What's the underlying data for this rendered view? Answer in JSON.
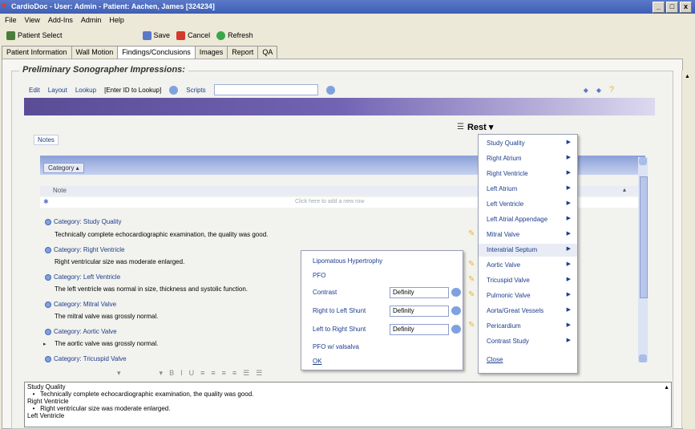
{
  "window": {
    "title": "CardioDoc - User: Admin - Patient: Aachen, James [324234]",
    "controls": [
      "_",
      "□",
      "x"
    ]
  },
  "menubar": [
    "File",
    "View",
    "Add-Ins",
    "Admin",
    "Help"
  ],
  "toolbar": {
    "patient_select": "Patient Select",
    "save": "Save",
    "cancel": "Cancel",
    "refresh": "Refresh"
  },
  "tabs": [
    "Patient Information",
    "Wall Motion",
    "Findings/Conclusions",
    "Images",
    "Report",
    "QA"
  ],
  "active_tab": "Findings/Conclusions",
  "section_title": "Preliminary Sonographer Impressions:",
  "inner_toolbar": {
    "edit": "Edit",
    "layout": "Layout",
    "lookup": "Lookup",
    "lookup_value": "[Enter ID to Lookup]",
    "scripts": "Scripts"
  },
  "rest_button": "Rest ▾",
  "notes_tab": "Notes",
  "grid": {
    "group_by": "Category ▴",
    "column_header": "Note",
    "new_row_hint": "Click here to add a new row",
    "rows": [
      {
        "category": "Category: Study Quality",
        "note": "Technically complete echocardiographic examination, the quality was good."
      },
      {
        "category": "Category: Right Ventricle",
        "note": "Right ventricular size was moderate enlarged."
      },
      {
        "category": "Category: Left Ventricle",
        "note": "The left ventricle was normal in size, thickness and systolic function."
      },
      {
        "category": "Category: Mitral Valve",
        "note": "The mitral valve was grossly normal."
      },
      {
        "category": "Category: Aortic Valve",
        "note": "The aortic valve was grossly normal."
      },
      {
        "category": "Category: Tricuspid Valve",
        "note": ""
      }
    ]
  },
  "format_bar": [
    "▾",
    "▾",
    "B",
    "I",
    "U",
    "≡",
    "≡",
    "≡",
    "≡",
    "☰",
    "☰"
  ],
  "textarea_lines": [
    "Study Quality",
    "   •   Technically complete echocardiographic examination, the quality was good.",
    "Right Ventricle",
    "   •   Right ventricular size was moderate enlarged.",
    "Left Ventricle"
  ],
  "submenu": {
    "items": [
      "Lipomatous Hypertrophy",
      "PFO"
    ],
    "contrast_label": "Contrast",
    "contrast_value": "Definity",
    "rl_shunt_label": "Right to Left Shunt",
    "rl_shunt_value": "Definity",
    "lr_shunt_label": "Left to Right Shunt",
    "lr_shunt_value": "Definity",
    "pfo_valsalva": "PFO w/ valsalva",
    "ok": "OK"
  },
  "main_menu": [
    {
      "label": "Study Quality",
      "arrow": true,
      "icon": false
    },
    {
      "label": "Right Atrium",
      "arrow": true,
      "icon": false
    },
    {
      "label": "Right Ventricle",
      "arrow": true,
      "icon": false
    },
    {
      "label": "Left Atrium",
      "arrow": true,
      "icon": false
    },
    {
      "label": "Left Ventricle",
      "arrow": true,
      "icon": false
    },
    {
      "label": "Left Atrial Appendage",
      "arrow": true,
      "icon": false
    },
    {
      "label": "Mitral Valve",
      "arrow": true,
      "icon": true
    },
    {
      "label": "Interatrial Septum",
      "arrow": true,
      "icon": false,
      "highlighted": true
    },
    {
      "label": "Aortic Valve",
      "arrow": true,
      "icon": true
    },
    {
      "label": "Tricuspid Valve",
      "arrow": true,
      "icon": true
    },
    {
      "label": "Pulmonic Valve",
      "arrow": true,
      "icon": true
    },
    {
      "label": "Aorta/Great Vessels",
      "arrow": true,
      "icon": false
    },
    {
      "label": "Pericardium",
      "arrow": true,
      "icon": true
    },
    {
      "label": "Contrast Study",
      "arrow": true,
      "icon": false
    },
    {
      "label": "Close",
      "arrow": false,
      "icon": false
    }
  ]
}
